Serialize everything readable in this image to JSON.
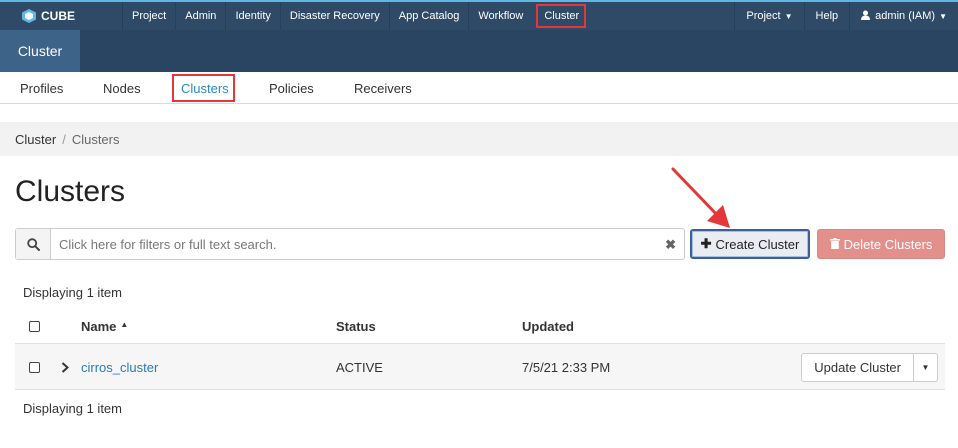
{
  "topbar": {
    "brand": "CUBE",
    "nav": [
      "Project",
      "Admin",
      "Identity",
      "Disaster Recovery",
      "App Catalog",
      "Workflow",
      "Cluster"
    ],
    "project_menu": "Project",
    "help": "Help",
    "user_menu": "admin (IAM)"
  },
  "dashboard": {
    "tab": "Cluster"
  },
  "subnav": {
    "items": [
      "Profiles",
      "Nodes",
      "Clusters",
      "Policies",
      "Receivers"
    ],
    "active": "Clusters"
  },
  "breadcrumb": {
    "root": "Cluster",
    "separator": "/",
    "current": "Clusters"
  },
  "page": {
    "title": "Clusters"
  },
  "toolbar": {
    "search_placeholder": "Click here for filters or full text search.",
    "create_label": "Create Cluster",
    "delete_label": "Delete Clusters"
  },
  "table": {
    "count_top": "Displaying 1 item",
    "count_bottom": "Displaying 1 item",
    "headers": {
      "name": "Name",
      "status": "Status",
      "updated": "Updated"
    },
    "rows": [
      {
        "name": "cirros_cluster",
        "status": "ACTIVE",
        "updated": "7/5/21 2:33 PM",
        "action": "Update Cluster"
      }
    ]
  },
  "colors": {
    "navbar": "#2f4a66",
    "accent": "#5fb7e5",
    "highlight": "#e3373a",
    "link": "#2a7ab8",
    "danger": "#e38f8c"
  }
}
